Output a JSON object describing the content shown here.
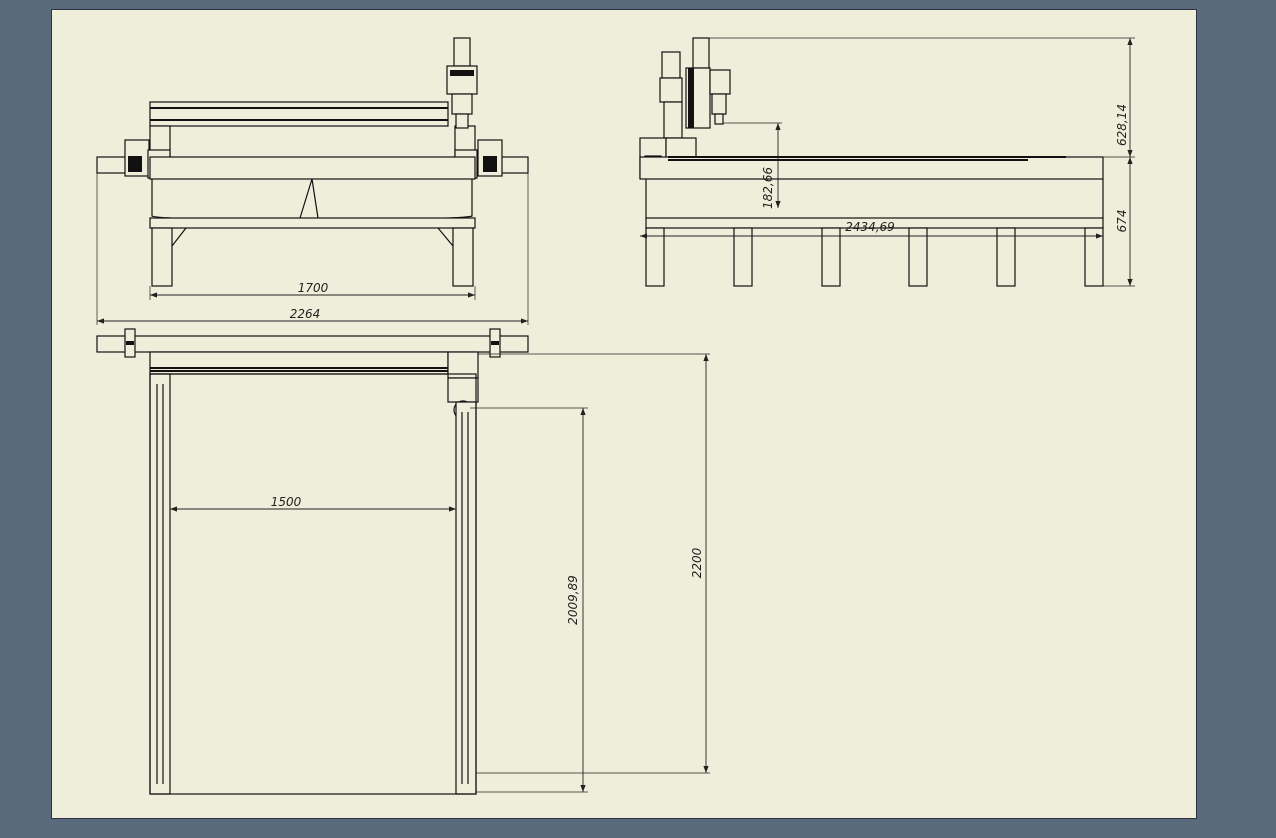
{
  "colors": {
    "background": "#5a6a7d",
    "sheet": "#efeedb",
    "line": "#111111"
  },
  "dimensions": {
    "front_inner_width": "1700",
    "front_overall_width": "2264",
    "side_height_top": "628,14",
    "side_height_table": "674",
    "side_clearance": "182,66",
    "side_length": "2434,69",
    "top_inner_width": "1500",
    "top_travel": "2009,89",
    "top_length": "2200"
  }
}
